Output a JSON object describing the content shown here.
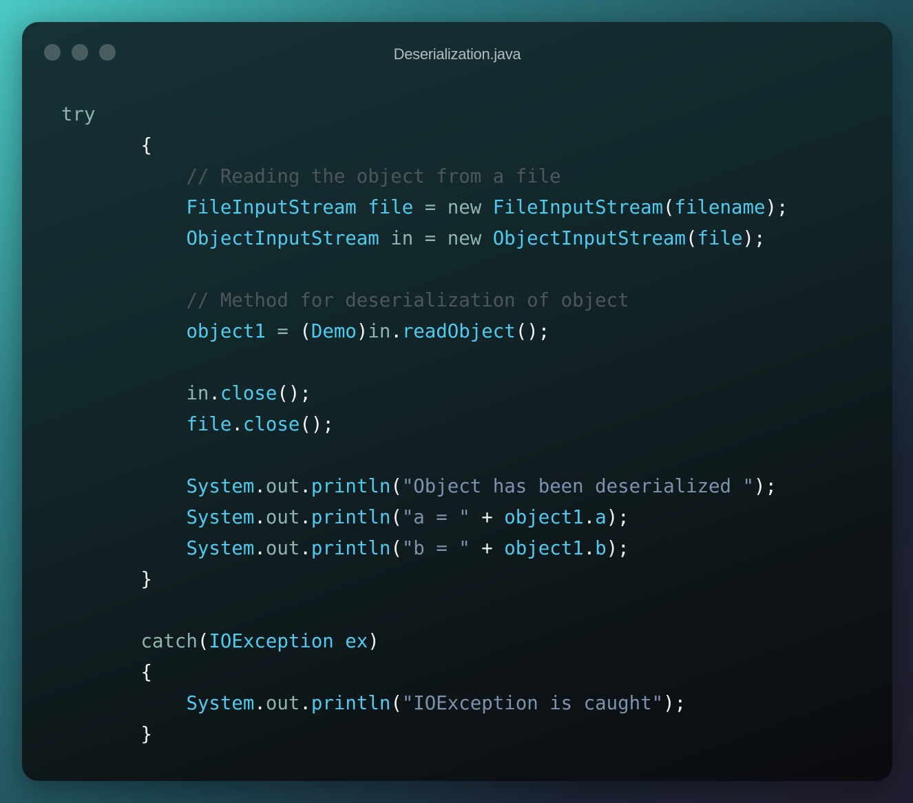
{
  "window": {
    "title": "Deserialization.java",
    "traffic_lights": [
      "close-dot",
      "minimize-dot",
      "maximize-dot"
    ]
  },
  "colors": {
    "keyword": "#8fb5b1",
    "type": "#4fcbef",
    "punct": "#f2f4f4",
    "string": "#7d92ad",
    "comment": "#4e565b"
  },
  "code": {
    "lines": [
      {
        "indent": 0,
        "tokens": [
          {
            "t": "try",
            "c": "kw"
          }
        ]
      },
      {
        "indent": 7,
        "tokens": [
          {
            "t": "{",
            "c": "p"
          }
        ]
      },
      {
        "indent": 11,
        "tokens": [
          {
            "t": "// Reading the object from a file",
            "c": "cm"
          }
        ]
      },
      {
        "indent": 11,
        "tokens": [
          {
            "t": "FileInputStream file",
            "c": "ty"
          },
          {
            "t": " = new ",
            "c": "kw"
          },
          {
            "t": "FileInputStream",
            "c": "ty"
          },
          {
            "t": "(",
            "c": "p"
          },
          {
            "t": "filename",
            "c": "ty"
          },
          {
            "t": ");",
            "c": "p"
          }
        ]
      },
      {
        "indent": 11,
        "tokens": [
          {
            "t": "ObjectInputStream",
            "c": "ty"
          },
          {
            "t": " in = new ",
            "c": "kw"
          },
          {
            "t": "ObjectInputStream",
            "c": "ty"
          },
          {
            "t": "(",
            "c": "p"
          },
          {
            "t": "file",
            "c": "ty"
          },
          {
            "t": ");",
            "c": "p"
          }
        ]
      },
      {
        "indent": 0,
        "tokens": []
      },
      {
        "indent": 11,
        "tokens": [
          {
            "t": "// Method for deserialization of object",
            "c": "cm"
          }
        ]
      },
      {
        "indent": 11,
        "tokens": [
          {
            "t": "object1",
            "c": "ty"
          },
          {
            "t": " = ",
            "c": "kw"
          },
          {
            "t": "(",
            "c": "p"
          },
          {
            "t": "Demo",
            "c": "ty"
          },
          {
            "t": ")",
            "c": "p"
          },
          {
            "t": "in",
            "c": "kw"
          },
          {
            "t": ".",
            "c": "p"
          },
          {
            "t": "readObject",
            "c": "ty"
          },
          {
            "t": "();",
            "c": "p"
          }
        ]
      },
      {
        "indent": 0,
        "tokens": []
      },
      {
        "indent": 11,
        "tokens": [
          {
            "t": "in",
            "c": "kw"
          },
          {
            "t": ".",
            "c": "p"
          },
          {
            "t": "close",
            "c": "ty"
          },
          {
            "t": "();",
            "c": "p"
          }
        ]
      },
      {
        "indent": 11,
        "tokens": [
          {
            "t": "file",
            "c": "ty"
          },
          {
            "t": ".",
            "c": "p"
          },
          {
            "t": "close",
            "c": "ty"
          },
          {
            "t": "();",
            "c": "p"
          }
        ]
      },
      {
        "indent": 0,
        "tokens": []
      },
      {
        "indent": 11,
        "tokens": [
          {
            "t": "System",
            "c": "ty"
          },
          {
            "t": ".",
            "c": "p"
          },
          {
            "t": "out",
            "c": "kw"
          },
          {
            "t": ".",
            "c": "p"
          },
          {
            "t": "println",
            "c": "ty"
          },
          {
            "t": "(",
            "c": "p"
          },
          {
            "t": "\"Object has been deserialized \"",
            "c": "s"
          },
          {
            "t": ");",
            "c": "p"
          }
        ]
      },
      {
        "indent": 11,
        "tokens": [
          {
            "t": "System",
            "c": "ty"
          },
          {
            "t": ".",
            "c": "p"
          },
          {
            "t": "out",
            "c": "kw"
          },
          {
            "t": ".",
            "c": "p"
          },
          {
            "t": "println",
            "c": "ty"
          },
          {
            "t": "(",
            "c": "p"
          },
          {
            "t": "\"a = \"",
            "c": "s"
          },
          {
            "t": " + ",
            "c": "p"
          },
          {
            "t": "object1",
            "c": "ty"
          },
          {
            "t": ".",
            "c": "p"
          },
          {
            "t": "a",
            "c": "ty"
          },
          {
            "t": ");",
            "c": "p"
          }
        ]
      },
      {
        "indent": 11,
        "tokens": [
          {
            "t": "System",
            "c": "ty"
          },
          {
            "t": ".",
            "c": "p"
          },
          {
            "t": "out",
            "c": "kw"
          },
          {
            "t": ".",
            "c": "p"
          },
          {
            "t": "println",
            "c": "ty"
          },
          {
            "t": "(",
            "c": "p"
          },
          {
            "t": "\"b = \"",
            "c": "s"
          },
          {
            "t": " + ",
            "c": "p"
          },
          {
            "t": "object1",
            "c": "ty"
          },
          {
            "t": ".",
            "c": "p"
          },
          {
            "t": "b",
            "c": "ty"
          },
          {
            "t": ");",
            "c": "p"
          }
        ]
      },
      {
        "indent": 7,
        "tokens": [
          {
            "t": "}",
            "c": "p"
          }
        ]
      },
      {
        "indent": 0,
        "tokens": []
      },
      {
        "indent": 7,
        "tokens": [
          {
            "t": "catch",
            "c": "kw"
          },
          {
            "t": "(",
            "c": "p"
          },
          {
            "t": "IOException ex",
            "c": "ty"
          },
          {
            "t": ")",
            "c": "p"
          }
        ]
      },
      {
        "indent": 7,
        "tokens": [
          {
            "t": "{",
            "c": "p"
          }
        ]
      },
      {
        "indent": 11,
        "tokens": [
          {
            "t": "System",
            "c": "ty"
          },
          {
            "t": ".",
            "c": "p"
          },
          {
            "t": "out",
            "c": "kw"
          },
          {
            "t": ".",
            "c": "p"
          },
          {
            "t": "println",
            "c": "ty"
          },
          {
            "t": "(",
            "c": "p"
          },
          {
            "t": "\"IOException is caught\"",
            "c": "s"
          },
          {
            "t": ");",
            "c": "p"
          }
        ]
      },
      {
        "indent": 7,
        "tokens": [
          {
            "t": "}",
            "c": "p"
          }
        ]
      }
    ]
  }
}
